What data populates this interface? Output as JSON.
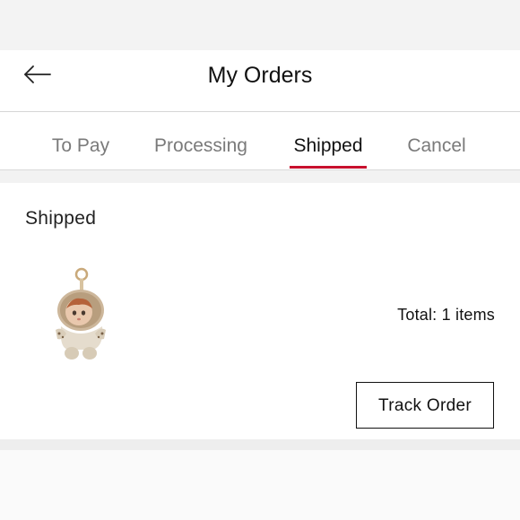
{
  "header": {
    "back_icon": "arrow-left-icon",
    "title": "My Orders"
  },
  "tabs": [
    {
      "label": "To Pay",
      "active": false
    },
    {
      "label": "Processing",
      "active": false
    },
    {
      "label": "Shipped",
      "active": true
    },
    {
      "label": "Cancel",
      "active": false
    }
  ],
  "order": {
    "status": "Shipped",
    "product_image": "plush-doll-keychain",
    "total": "Total: 1 items",
    "track_label": "Track Order"
  },
  "colors": {
    "accent": "#c8102e",
    "active_tab_text": "#111111",
    "inactive_tab_text": "#7a7a7a"
  }
}
